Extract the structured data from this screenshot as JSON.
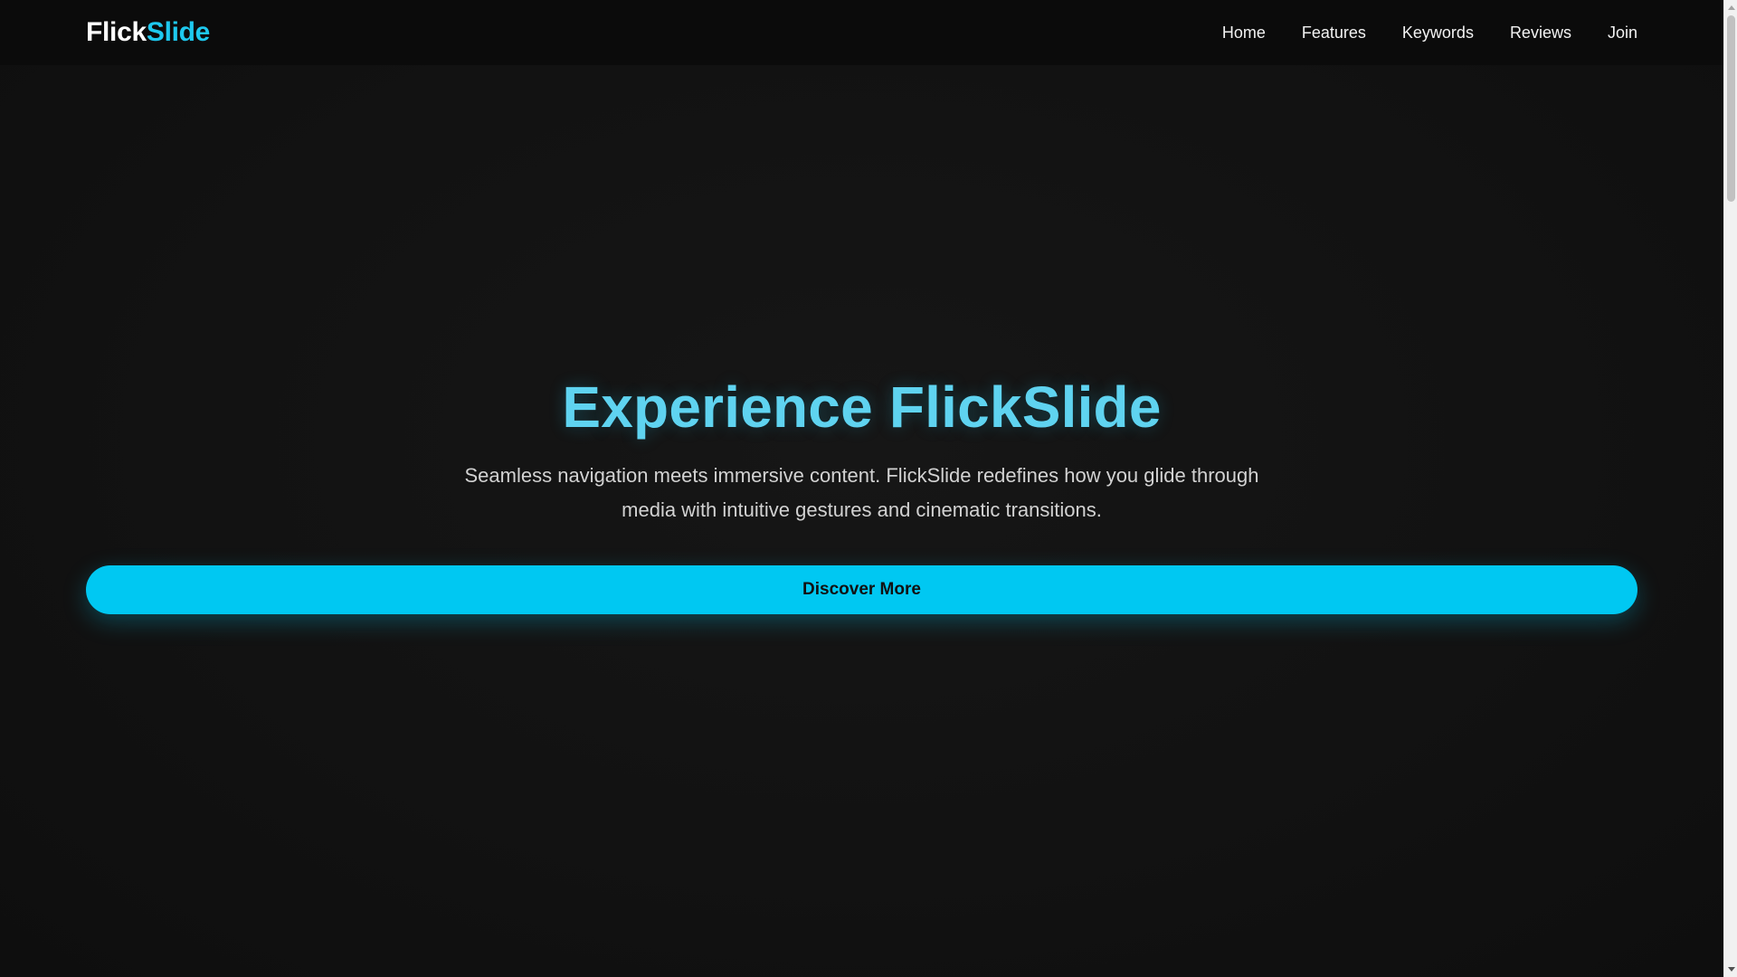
{
  "header": {
    "logo": {
      "part1": "Flick",
      "part2": "Slide"
    },
    "nav": [
      {
        "label": "Home"
      },
      {
        "label": "Features"
      },
      {
        "label": "Keywords"
      },
      {
        "label": "Reviews"
      },
      {
        "label": "Join"
      }
    ]
  },
  "hero": {
    "title": "Experience FlickSlide",
    "subtitle": "Seamless navigation meets immersive content. FlickSlide redefines how you glide through media with intuitive gestures and cinematic transitions.",
    "cta_label": "Discover More"
  },
  "colors": {
    "background": "#111111",
    "header_background": "#0b0b0b",
    "accent": "#00c8f2",
    "title": "#5fd3f0",
    "text": "#d2d2d2"
  },
  "icons": {
    "scroll_up": "scroll-up-arrow-icon",
    "scroll_down": "scroll-down-arrow-icon"
  }
}
